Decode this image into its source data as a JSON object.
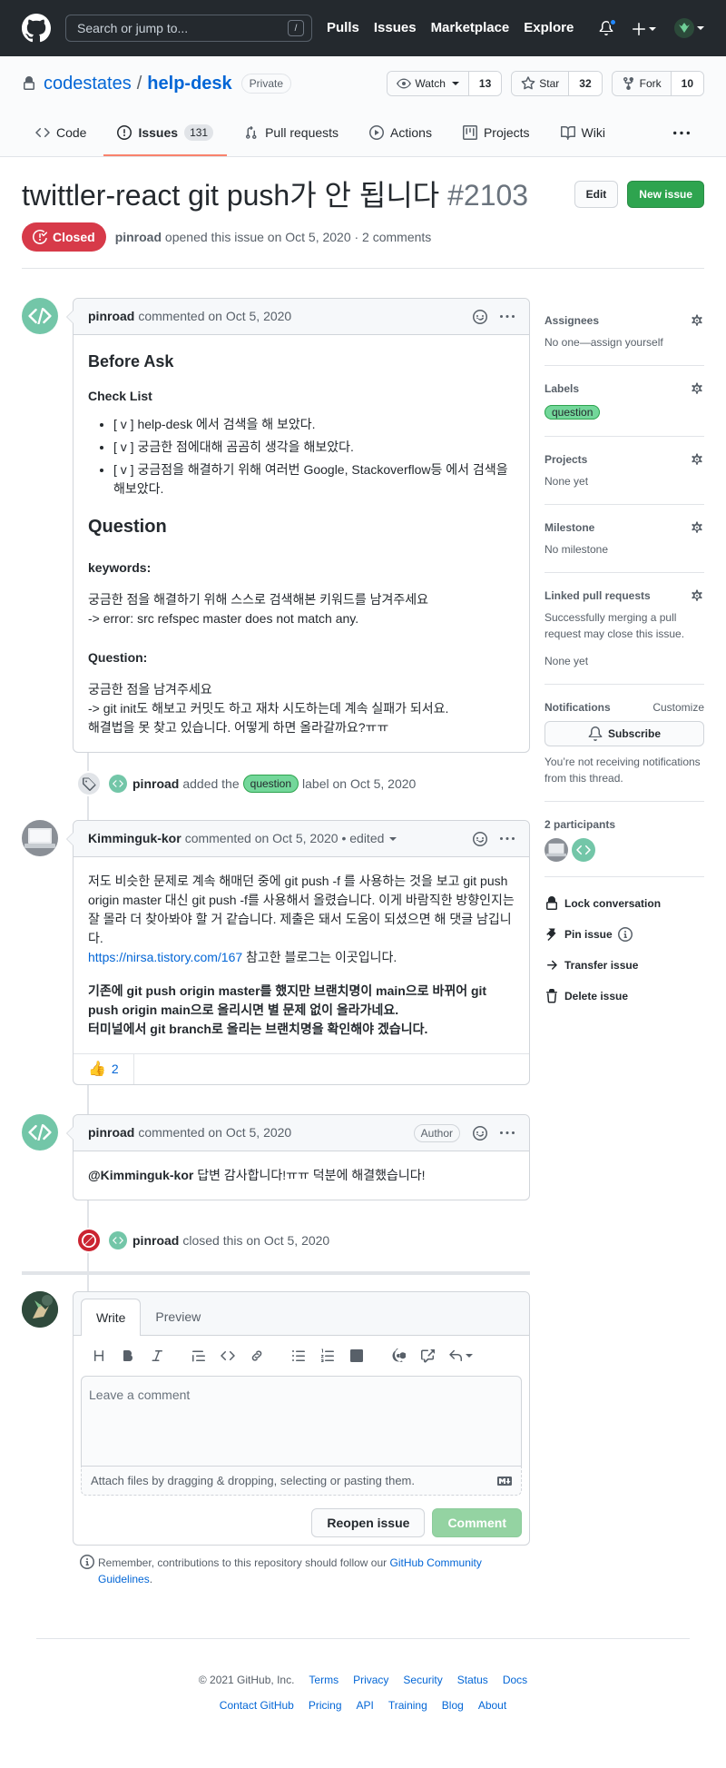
{
  "header": {
    "search_placeholder": "Search or jump to...",
    "slash": "/",
    "nav": [
      "Pulls",
      "Issues",
      "Marketplace",
      "Explore"
    ]
  },
  "repo": {
    "owner": "codestates",
    "sep": "/",
    "name": "help-desk",
    "visibility": "Private",
    "watch_label": "Watch",
    "watch_count": "13",
    "star_label": "Star",
    "star_count": "32",
    "fork_label": "Fork",
    "fork_count": "10"
  },
  "tabs": {
    "code": "Code",
    "issues": "Issues",
    "issues_count": "131",
    "pulls": "Pull requests",
    "actions": "Actions",
    "projects": "Projects",
    "wiki": "Wiki"
  },
  "issue": {
    "title": "twittler-react git push가 안 됩니다",
    "number": "#2103",
    "edit_label": "Edit",
    "new_issue_label": "New issue",
    "state": "Closed",
    "author": "pinroad",
    "opened_text": "opened this issue on Oct 5, 2020 · 2 comments"
  },
  "comment1": {
    "author": "pinroad",
    "meta": "commented on Oct 5, 2020",
    "h_before": "Before Ask",
    "h_checklist": "Check List",
    "checks": [
      "[ v ] help-desk 에서 검색을 해 보았다.",
      "[ v ] 궁금한 점에대해 곰곰히 생각을 해보았다.",
      "[ v ] 궁금점을 해결하기 위해 여러번 Google, Stackoverflow등 에서 검색을 해보았다."
    ],
    "h_question": "Question",
    "h_keywords": "keywords:",
    "kw_line1": "궁금한 점을 해결하기 위해 스스로 검색해본 키워드를 남겨주세요",
    "kw_line2": "-> error: src refspec master does not match any.",
    "h_question2": "Question:",
    "q_line1": "궁금한 점을 남겨주세요",
    "q_line2": "-> git init도 해보고 커밋도 하고 재차 시도하는데 계속 실패가 되서요.",
    "q_line3": "해결법을 못 찾고 있습니다. 어떻게 하면 올라갈까요?ㅠㅠ"
  },
  "event_label": {
    "actor": "pinroad",
    "pre": "added the",
    "label": "question",
    "post": "label on Oct 5, 2020",
    "label_color": "#73d79a"
  },
  "comment2": {
    "author": "Kimminguk-kor",
    "meta": "commented on Oct 5, 2020",
    "edited": "• edited",
    "p1": "저도 비슷한 문제로 계속 해매던 중에 git push -f 를 사용하는 것을 보고 git push origin master 대신 git push -f를 사용해서 올렸습니다. 이게 바람직한 방향인지는 잘 몰라 더 찾아봐야 할 거 같습니다. 제출은 돼서 도움이 되셨으면 해 댓글 남깁니다.",
    "link": "https://nirsa.tistory.com/167",
    "link_after": " 참고한 블로그는 이곳입니다.",
    "b1": "기존에 git push origin master를 했지만 브랜치명이 main으로 바뀌어 git push origin main으로 올리시면 별 문제 없이 올라가네요.",
    "b2": "터미널에서 git branch로 올리는 브랜치명을 확인해야 겠습니다.",
    "reaction_count": "2"
  },
  "comment3": {
    "author": "pinroad",
    "meta": "commented on Oct 5, 2020",
    "author_badge": "Author",
    "mention": "@Kimminguk-kor",
    "text": " 답변 감사합니다!ㅠㅠ 덕분에 해결했습니다!"
  },
  "event_closed": {
    "actor": "pinroad",
    "text": "closed this on Oct 5, 2020"
  },
  "form": {
    "write": "Write",
    "preview": "Preview",
    "placeholder": "Leave a comment",
    "attach": "Attach files by dragging & dropping, selecting or pasting them.",
    "reopen": "Reopen issue",
    "comment": "Comment",
    "remember_pre": "Remember, contributions to this repository should follow our ",
    "remember_link": "GitHub Community Guidelines",
    "remember_post": "."
  },
  "sidebar": {
    "assignees": "Assignees",
    "assignees_val": "No one—assign yourself",
    "labels": "Labels",
    "labels_val": "question",
    "projects": "Projects",
    "projects_val": "None yet",
    "milestone": "Milestone",
    "milestone_val": "No milestone",
    "linked": "Linked pull requests",
    "linked_desc": "Successfully merging a pull request may close this issue.",
    "linked_val": "None yet",
    "notifications": "Notifications",
    "customize": "Customize",
    "subscribe": "Subscribe",
    "notif_desc": "You’re not receiving notifications from this thread.",
    "participants": "2 participants",
    "lock": "Lock conversation",
    "pin": "Pin issue",
    "transfer": "Transfer issue",
    "delete": "Delete issue"
  },
  "footer": {
    "copy": "© 2021 GitHub, Inc.",
    "row1": [
      "Terms",
      "Privacy",
      "Security",
      "Status",
      "Docs"
    ],
    "row2": [
      "Contact GitHub",
      "Pricing",
      "API",
      "Training",
      "Blog",
      "About"
    ]
  },
  "colors": {
    "accent_link": "#0366d6",
    "closed_red": "#d73a49",
    "green_button": "#2ea44f",
    "tab_underline": "#f9826c"
  }
}
